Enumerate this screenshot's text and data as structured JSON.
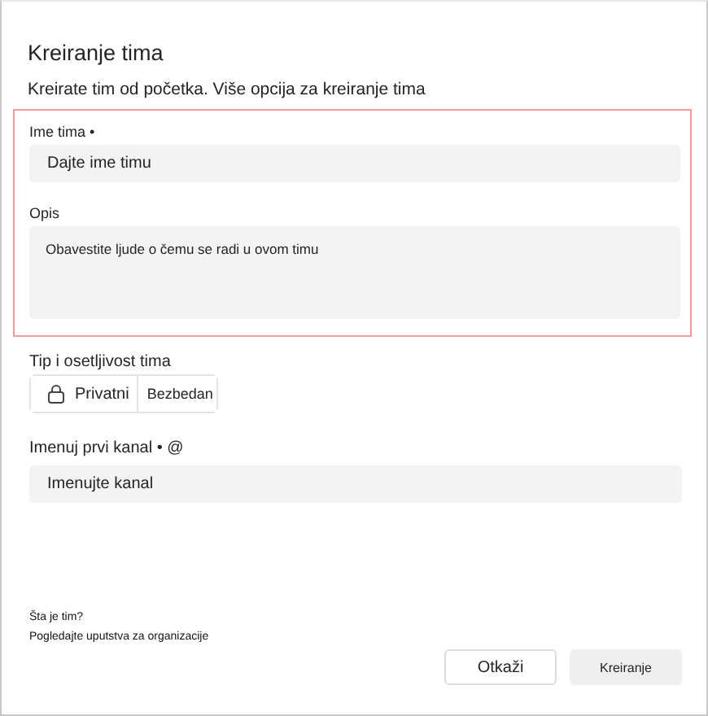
{
  "dialog": {
    "title": "Kreiranje tima",
    "subtitle": "Kreirate tim od početka. Više opcija za kreiranje tima"
  },
  "details": {
    "highlighted": true,
    "name_field": {
      "label": "Ime tima •",
      "placeholder": "Dajte ime timu"
    },
    "description_field": {
      "label": "Opis",
      "placeholder": "Obavestite ljude o čemu se radi u ovom timu"
    }
  },
  "team_type": {
    "label": "Tip i osetljivost tima",
    "privacy": "Privatni",
    "sensitivity": "Bezbedan"
  },
  "channel_field": {
    "label": "Imenuj prvi kanal • @",
    "placeholder": "Imenujte kanal"
  },
  "help": {
    "question": "Šta je tim?",
    "link": "Pogledajte uputstva za organizacije"
  },
  "buttons": [
    {
      "label": "Otkaži",
      "kind": "secondary"
    },
    {
      "label": "Kreiranje",
      "kind": "primary"
    }
  ]
}
